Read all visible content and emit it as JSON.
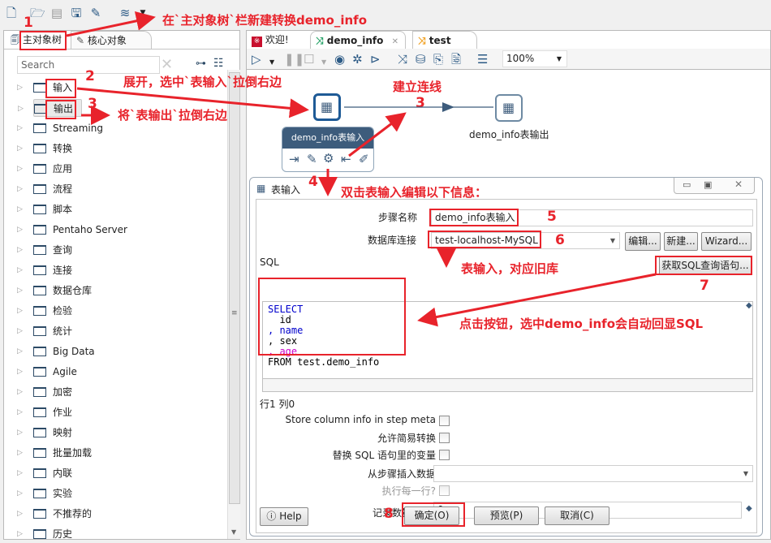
{
  "toolbar_top": {
    "icons": [
      "new-file-icon",
      "open-file-icon",
      "explore-icon",
      "save-icon",
      "save-as-icon",
      "layers-icon",
      "dropdown-icon"
    ]
  },
  "left_panel": {
    "tabs": [
      {
        "label": "主对象树",
        "icon": "search-doc-icon",
        "active": true
      },
      {
        "label": "核心对象",
        "icon": "pencil-icon",
        "active": false
      }
    ],
    "search_placeholder": "Search",
    "tree_items": [
      "输入",
      "输出",
      "Streaming",
      "转换",
      "应用",
      "流程",
      "脚本",
      "Pentaho Server",
      "查询",
      "连接",
      "数据仓库",
      "检验",
      "统计",
      "Big Data",
      "Agile",
      "加密",
      "作业",
      "映射",
      "批量加载",
      "内联",
      "实验",
      "不推荐的",
      "历史"
    ]
  },
  "editor_tabs": [
    {
      "label": "欢迎!",
      "icon": "welcome-icon"
    },
    {
      "label": "demo_info",
      "icon": "transformation-icon",
      "active": true,
      "closable": true
    },
    {
      "label": "test",
      "icon": "transformation-orange-icon"
    }
  ],
  "editor_toolbar": {
    "zoom_value": "100%"
  },
  "canvas": {
    "step_input_label": "demo_info表输入",
    "step_output_label": "demo_info表输出"
  },
  "dialog": {
    "title": "表输入",
    "step_name_label": "步骤名称",
    "step_name_value": "demo_info表输入",
    "db_conn_label": "数据库连接",
    "db_conn_value": "test-localhost-MySQL",
    "edit_button": "编辑...",
    "new_button": "新建...",
    "wizard_button": "Wizard...",
    "sql_label": "SQL",
    "get_sql_button": "获取SQL查询语句...",
    "sql_lines": [
      {
        "text": "SELECT",
        "color": "#0000cc"
      },
      {
        "text": "  id",
        "color": "#000000"
      },
      {
        "text": ", name",
        "color": "#0000cc"
      },
      {
        "text": ", sex",
        "color": "#000000"
      },
      {
        "text": ", age",
        "color": "#cc00cc"
      },
      {
        "text": "FROM test.demo_info",
        "color": "#000000"
      }
    ],
    "cursor_pos": "行1 列0",
    "store_column_label": "Store column info in step meta",
    "lazy_conversion_label": "允许简易转换",
    "replace_vars_label": "替换 SQL 语句里的变量",
    "insert_from_step_label": "从步骤插入数据",
    "insert_from_step_value": "",
    "execute_each_row_label": "执行每一行?",
    "limit_label": "记录数量限制",
    "limit_value": "0",
    "help_button": "Help",
    "ok_button": "确定(O)",
    "preview_button": "预览(P)",
    "cancel_button": "取消(C)"
  },
  "annotations": {
    "a1": "在`主对象树`栏新建转换demo_info",
    "a2": "展开，选中`表输入`拉倒右边",
    "a3": "将`表输出`拉倒右边",
    "a3b": "建立连线",
    "a4": "双击表输入编辑以下信息：",
    "a6": "表输入，对应旧库",
    "a7": "点击按钮，选中demo_info会自动回显SQL",
    "n1": "1",
    "n2": "2",
    "n3": "3",
    "n3b": "3",
    "n4": "4",
    "n5": "5",
    "n6": "6",
    "n7": "7",
    "n8": "8"
  },
  "colors": {
    "annotation": "#e8232b",
    "accent": "#1e5a96"
  }
}
